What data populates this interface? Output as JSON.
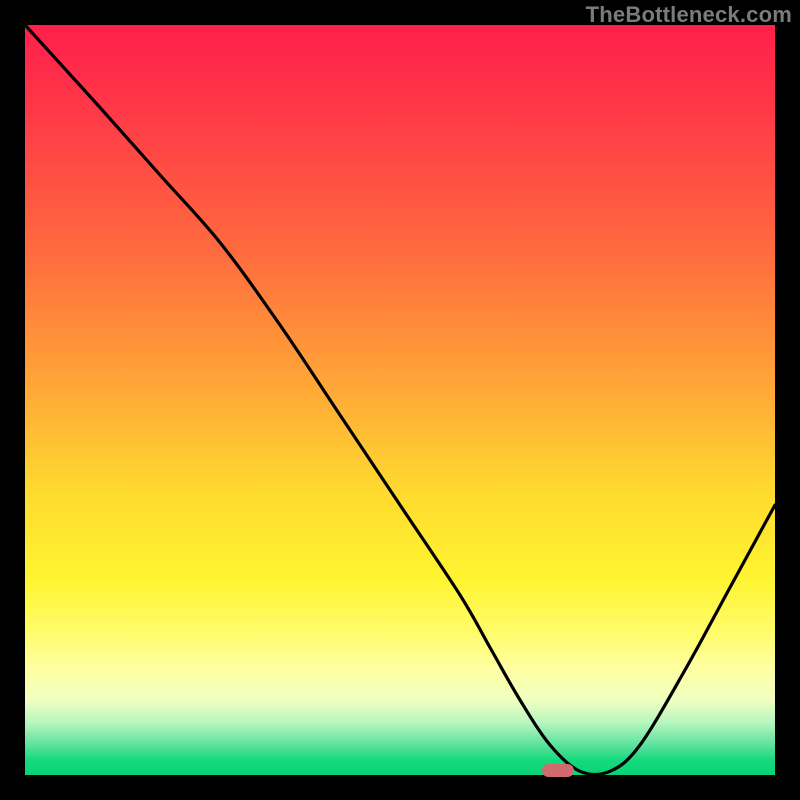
{
  "watermark": "TheBottleneck.com",
  "colors": {
    "frame": "#000000",
    "curve": "#000000",
    "marker": "#cf6b6f",
    "gradient_top": "#ff1f4b",
    "gradient_bottom": "#07d375"
  },
  "chart_data": {
    "type": "line",
    "title": "",
    "xlabel": "",
    "ylabel": "",
    "xlim": [
      0,
      100
    ],
    "ylim": [
      0,
      100
    ],
    "x": [
      0,
      10,
      18,
      26,
      34,
      42,
      50,
      58,
      62,
      66,
      70,
      74,
      78,
      82,
      88,
      94,
      100
    ],
    "values": [
      100,
      89,
      80,
      71,
      60,
      48,
      36,
      24,
      17,
      10,
      4,
      0.5,
      0.5,
      4,
      14,
      25,
      36
    ],
    "marker": {
      "x": 71,
      "y": 0.7
    },
    "notes": "Gradient background runs red (top, high bottleneck) to green (bottom, low bottleneck); black curve dips to ~0 near x≈72-76 indicating optimal match; small rounded marker sits at the minimum."
  }
}
